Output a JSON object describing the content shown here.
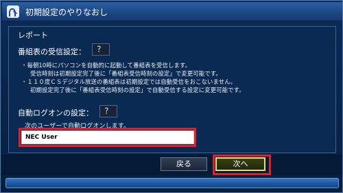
{
  "window": {
    "title": "初期設定のやりなおし",
    "title_icon": "setup-wrench-icon"
  },
  "content": {
    "report_label": "レポート",
    "epg_section": {
      "label": "番組表の受信設定：",
      "help_label": "？",
      "lines": [
        "・毎朝10時にパソコンを自動的に起動して番組表を受信します。",
        "受信時刻は初期設定完了後に「番組表受信時刻の設定」で変更可能です。",
        "・１１０度ＣＳデジタル放送の番組表は初期設定では自動受信をおこないません。",
        "初期設定完了後に「番組表受信時刻の設定」で自動受信する設定に変更可能です。"
      ]
    },
    "autologon_section": {
      "label": "自動ログオンの設定：",
      "help_label": "？",
      "description": "次のユーザーで自動ログオンします。",
      "user_name": "NEC User"
    }
  },
  "buttons": {
    "back_label": "戻る",
    "next_label": "次へ"
  },
  "colors": {
    "highlight": "#e0202a",
    "next_focus": "#e6e25a",
    "window_bg": "#0b2a52",
    "titlebar": "#1c4784"
  }
}
